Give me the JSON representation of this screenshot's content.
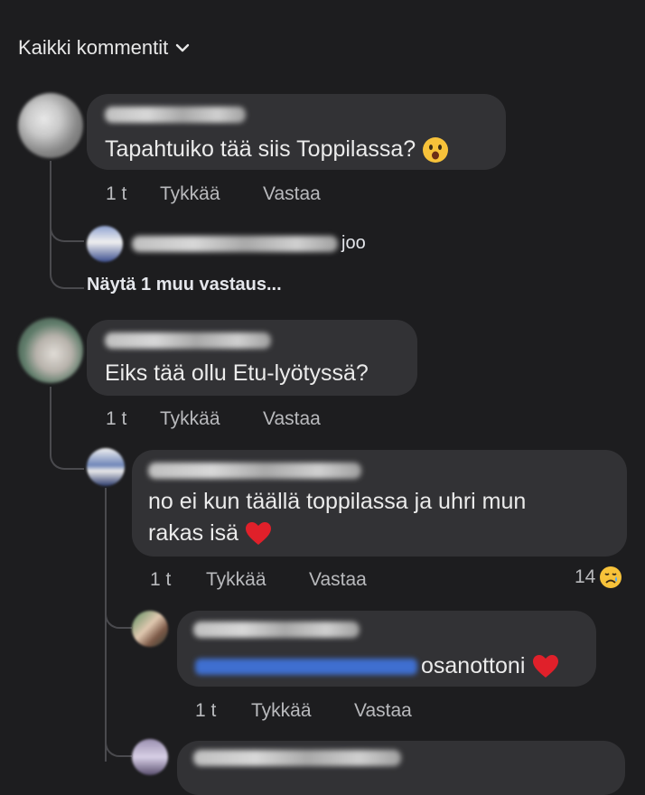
{
  "header": {
    "title": "Kaikki kommentit"
  },
  "comments": [
    {
      "text": "Tapahtuiko tää siis Toppilassa?",
      "time": "1 t",
      "like": "Tykkää",
      "reply": "Vastaa",
      "replies_preview": {
        "text": "joo"
      },
      "more_replies": "Näytä 1 muu vastaus..."
    },
    {
      "text": "Eiks tää ollu Etu-lyötyssä?",
      "time": "1 t",
      "like": "Tykkää",
      "reply": "Vastaa",
      "replies": [
        {
          "text_line1": "no ei kun täällä toppilassa ja uhri mun",
          "text_line2": "rakas isä",
          "time": "1 t",
          "like": "Tykkää",
          "reply": "Vastaa",
          "reaction_count": "14",
          "sub_reply": {
            "text": "osanottoni",
            "time": "1 t",
            "like": "Tykkää",
            "reply": "Vastaa"
          }
        }
      ]
    }
  ],
  "icons": {
    "header_chevron": "chevron-down-icon",
    "astonished_emoji": "astonished-face-emoji",
    "heart_emoji": "red-heart-emoji",
    "crying_emoji": "crying-face-emoji"
  },
  "colors": {
    "background": "#1d1d1f",
    "bubble": "#323235",
    "link": "#4a84ff",
    "heart": "#e0202a"
  }
}
